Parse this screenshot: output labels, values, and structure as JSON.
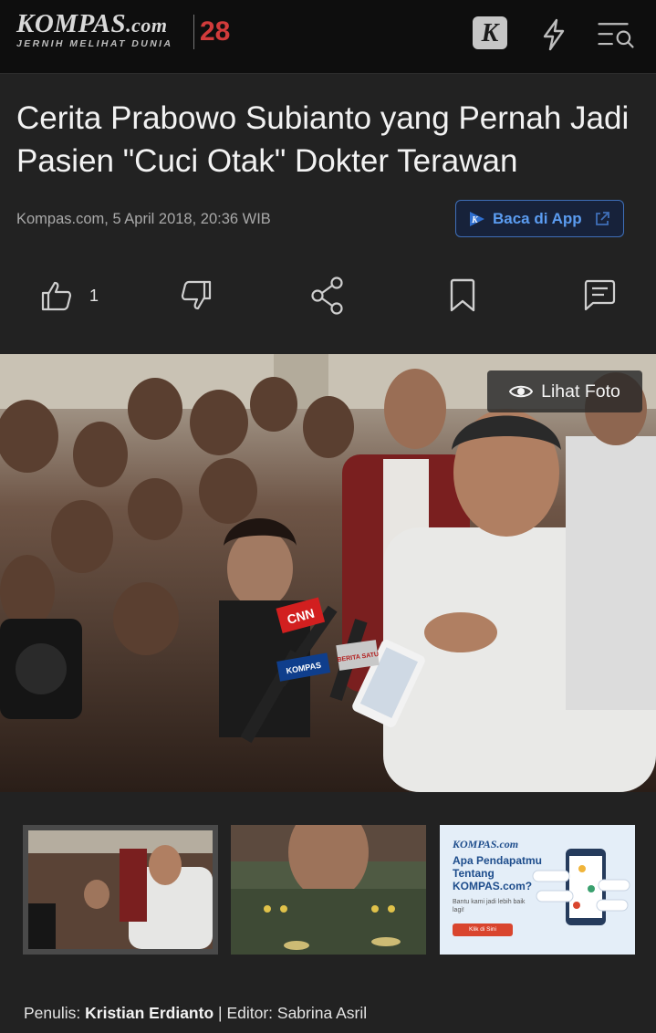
{
  "header": {
    "brand": "KOMPAS",
    "brand_suffix": ".com",
    "tagline": "JERNIH MELIHAT DUNIA",
    "anniversary": "28",
    "k_icon_letter": "K",
    "icons": [
      "kompas-k-icon",
      "lightning-icon",
      "menu-search-icon"
    ]
  },
  "article": {
    "title": "Cerita Prabowo Subianto yang Pernah Jadi Pasien \"Cuci Otak\" Dokter Terawan",
    "byline": "Kompas.com, 5 April 2018, 20:36 WIB",
    "app_button_label": "Baca di App"
  },
  "actions": {
    "like_count": "1",
    "icons": [
      "thumbs-up-icon",
      "thumbs-down-icon",
      "share-icon",
      "bookmark-icon",
      "comment-icon"
    ]
  },
  "photo": {
    "view_label": "Lihat Foto",
    "overlay_texts": [
      "CNN",
      "KOMPAS",
      "BERITA SATU"
    ]
  },
  "gallery": {
    "promo_logo": "KOMPAS.com",
    "promo_title": "Apa Pendapatmu Tentang KOMPAS.com?",
    "promo_sub": "Bantu kami jadi lebih baik lagi!",
    "promo_button": "Klik di Sini"
  },
  "credits": {
    "writer_label": "Penulis:",
    "writer": "Kristian Erdianto",
    "separator": "|",
    "editor_label": "Editor:",
    "editor": "Sabrina Asril"
  },
  "colors": {
    "background": "#222222",
    "topbar": "#0e0e0e",
    "accent_blue": "#5b9cf0",
    "anniv_red": "#d13b3b"
  }
}
